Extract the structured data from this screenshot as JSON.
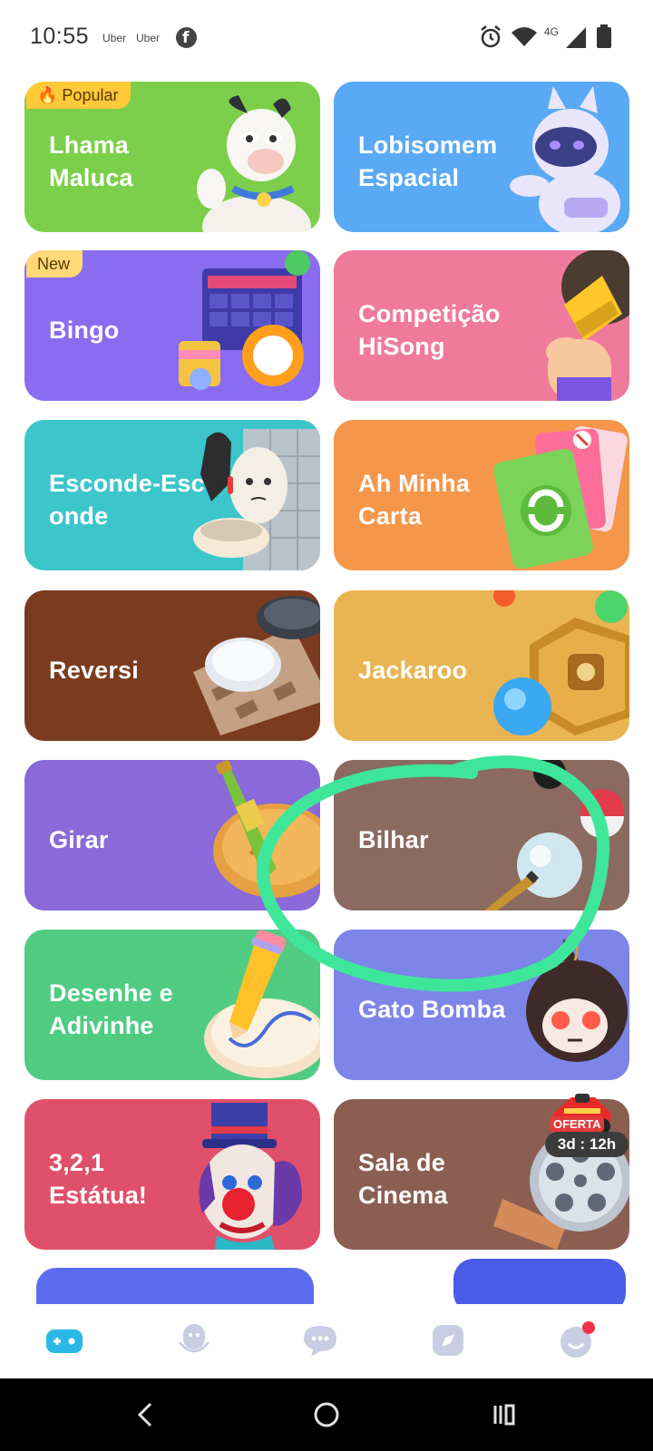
{
  "status_bar": {
    "time": "10:55",
    "notifications": [
      "Uber",
      "Uber"
    ],
    "network": "4G",
    "icons": [
      "facebook-icon",
      "alarm-icon",
      "wifi-icon",
      "signal-icon",
      "battery-icon"
    ]
  },
  "games": [
    {
      "name": "Lhama Maluca",
      "badge": "Popular",
      "color": "#7ccf4a"
    },
    {
      "name": "Lobisomem Espacial",
      "color": "#5aa9f4"
    },
    {
      "name": "Bingo",
      "badge": "New",
      "color": "#8a6cf0"
    },
    {
      "name": "Competição HiSong",
      "color": "#f07a9c"
    },
    {
      "name": "Esconde-Esc onde",
      "color": "#3cc6cc"
    },
    {
      "name": "Ah Minha Carta",
      "color": "#f5964a"
    },
    {
      "name": "Reversi",
      "color": "#7a3b1e"
    },
    {
      "name": "Jackaroo",
      "color": "#e9b553"
    },
    {
      "name": "Girar",
      "color": "#8a6ad8"
    },
    {
      "name": "Bilhar",
      "color": "#8b6a60"
    },
    {
      "name": "Desenhe e Adivinhe",
      "color": "#4fcc82"
    },
    {
      "name": "Gato Bomba",
      "color": "#7d86e8"
    },
    {
      "name": "3,2,1 Estátua!",
      "color": "#e0506a"
    },
    {
      "name": "Sala de Cinema",
      "color": "#8b5e52"
    }
  ],
  "offer": {
    "label": "OFERTA",
    "timer": "3d : 12h"
  },
  "bottom_nav": [
    {
      "icon": "gamepad-icon",
      "active": true
    },
    {
      "icon": "voice-room-icon"
    },
    {
      "icon": "chat-icon"
    },
    {
      "icon": "discover-icon"
    },
    {
      "icon": "profile-icon",
      "has_dot": true
    }
  ],
  "system_nav": [
    "back-icon",
    "home-icon",
    "recents-icon"
  ],
  "colors": {
    "accent": "#2bb8e6",
    "highlight_circle": "#3ee69a"
  }
}
